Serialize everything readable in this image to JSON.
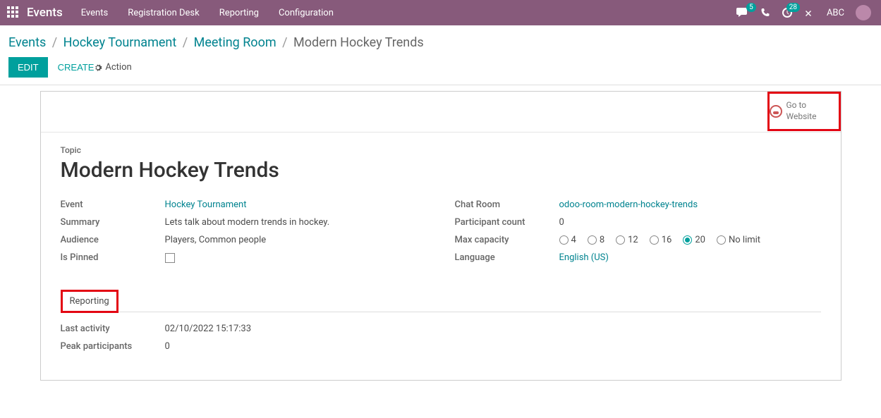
{
  "topbar": {
    "app_name": "Events",
    "nav": [
      "Events",
      "Registration Desk",
      "Reporting",
      "Configuration"
    ],
    "chat_badge": "5",
    "activities_badge": "28",
    "user": "ABC"
  },
  "breadcrumb": {
    "root": "Events",
    "level1": "Hockey Tournament",
    "level2": "Meeting Room",
    "current": "Modern Hockey Trends"
  },
  "actions": {
    "edit": "EDIT",
    "create": "CREATE",
    "action_menu": "Action"
  },
  "goto_website": "Go to Website",
  "form": {
    "topic_label": "Topic",
    "topic_value": "Modern Hockey Trends",
    "left": {
      "event_label": "Event",
      "event_value": "Hockey Tournament",
      "summary_label": "Summary",
      "summary_value": "Lets talk about modern trends in hockey.",
      "audience_label": "Audience",
      "audience_value": "Players, Common people",
      "pinned_label": "Is Pinned"
    },
    "right": {
      "chatroom_label": "Chat Room",
      "chatroom_value": "odoo-room-modern-hockey-trends",
      "participant_label": "Participant count",
      "participant_value": "0",
      "maxcap_label": "Max capacity",
      "maxcap_options": [
        "4",
        "8",
        "12",
        "16",
        "20",
        "No limit"
      ],
      "maxcap_selected": "20",
      "language_label": "Language",
      "language_value": "English (US)"
    }
  },
  "tab": {
    "reporting": "Reporting"
  },
  "reporting": {
    "last_activity_label": "Last activity",
    "last_activity_value": "02/10/2022 15:17:33",
    "peak_label": "Peak participants",
    "peak_value": "0"
  }
}
